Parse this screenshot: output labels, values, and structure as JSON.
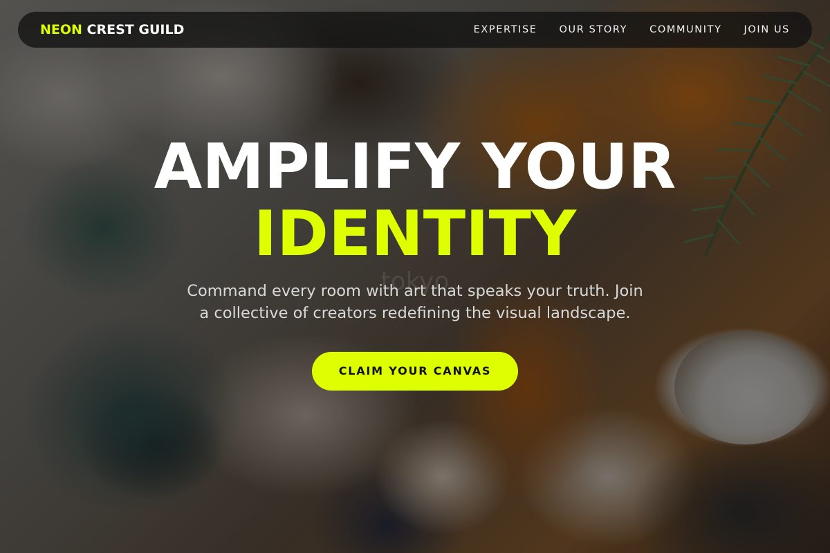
{
  "theme": {
    "accent": "#ddff00",
    "nav_background": "#121212",
    "text_light": "#ffffff"
  },
  "navbar": {
    "brand_accent": "NEON",
    "brand_rest": " CREST GUILD",
    "links": [
      {
        "label": "EXPERTISE"
      },
      {
        "label": "OUR STORY"
      },
      {
        "label": "COMMUNITY"
      },
      {
        "label": "JOIN US"
      }
    ]
  },
  "hero": {
    "headline_line1": "AMPLIFY YOUR",
    "headline_line2": "IDENTITY",
    "subtitle": "Command every room with art that speaks your truth. Join a collective of creators redefining the visual landscape.",
    "cta_label": "CLAIM YOUR CANVAS",
    "background_image": "textured oil paint palette with rosemary sprig",
    "watermark": "tokyo"
  }
}
